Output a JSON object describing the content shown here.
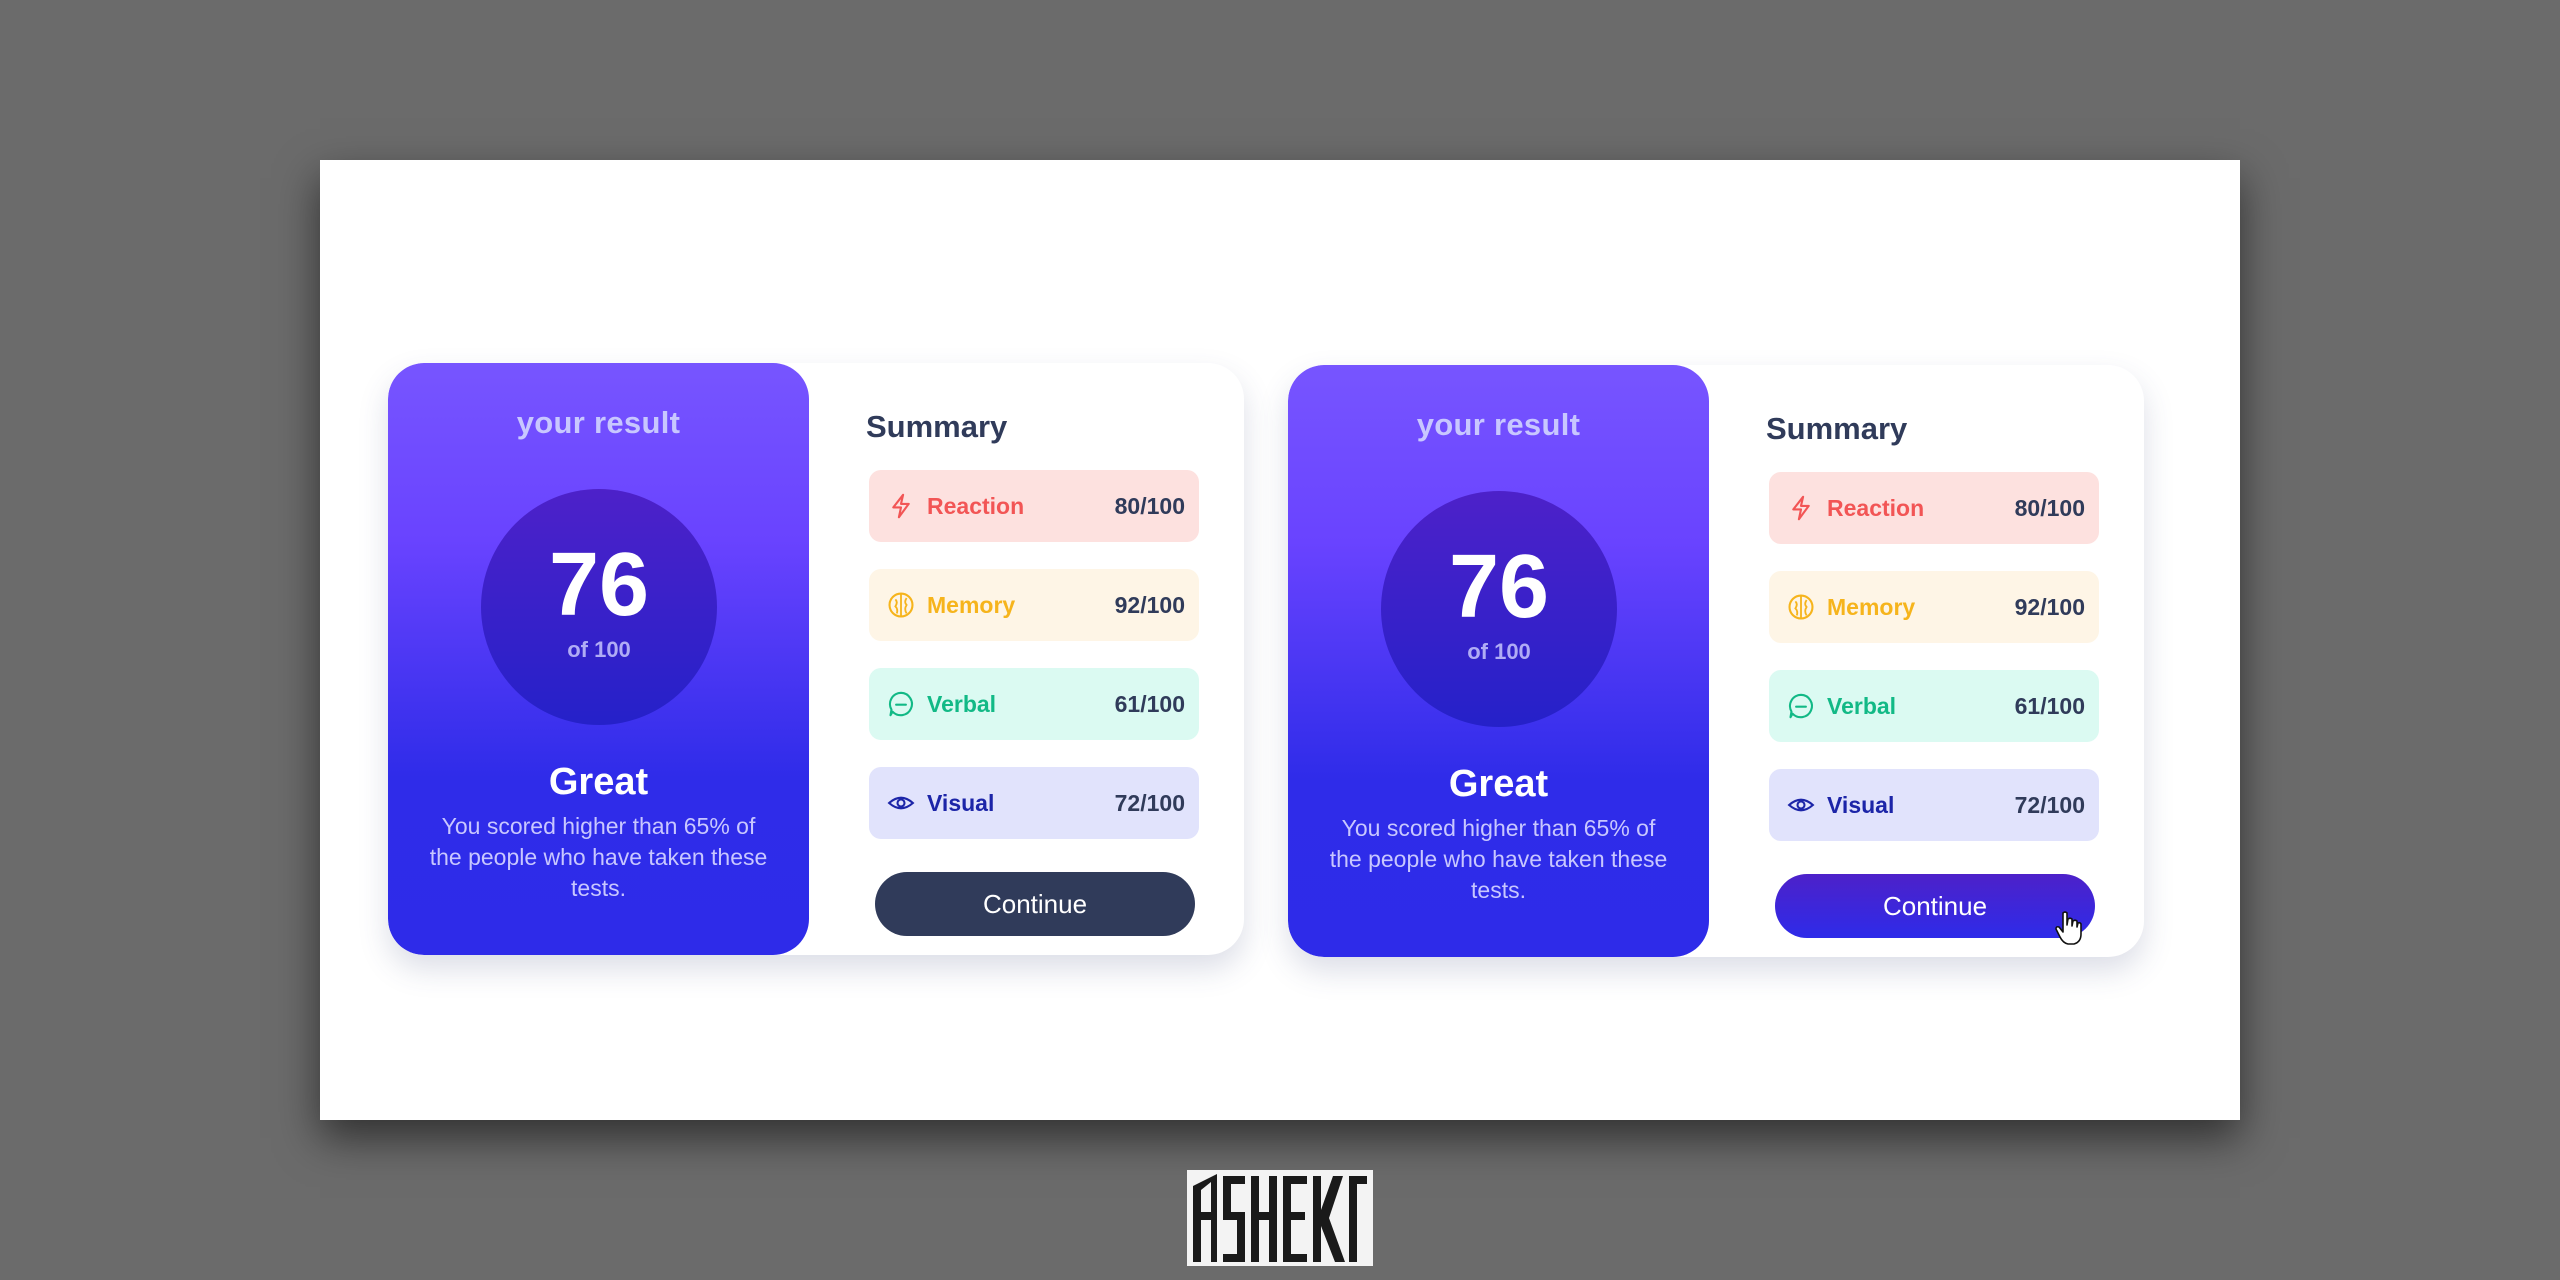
{
  "cards": [
    {
      "result_title": "your result",
      "score": "76",
      "score_of": "of 100",
      "grade": "Great",
      "description": "You scored higher than 65% of the people who have taken these tests.",
      "summary_title": "Summary",
      "rows": [
        {
          "icon": "lightning-icon",
          "label": "Reaction",
          "value": "80/100"
        },
        {
          "icon": "brain-icon",
          "label": "Memory",
          "value": "92/100"
        },
        {
          "icon": "chat-bubble-icon",
          "label": "Verbal",
          "value": "61/100"
        },
        {
          "icon": "eye-icon",
          "label": "Visual",
          "value": "72/100"
        }
      ],
      "button": "Continue",
      "button_state": "default"
    },
    {
      "result_title": "your result",
      "score": "76",
      "score_of": "of 100",
      "grade": "Great",
      "description": "You scored higher than 65% of the people who have taken these tests.",
      "summary_title": "Summary",
      "rows": [
        {
          "icon": "lightning-icon",
          "label": "Reaction",
          "value": "80/100"
        },
        {
          "icon": "brain-icon",
          "label": "Memory",
          "value": "92/100"
        },
        {
          "icon": "chat-bubble-icon",
          "label": "Verbal",
          "value": "61/100"
        },
        {
          "icon": "eye-icon",
          "label": "Visual",
          "value": "72/100"
        }
      ],
      "button": "Continue",
      "button_state": "hover"
    }
  ],
  "colors": {
    "reaction": "#f25555",
    "memory": "#f6b41c",
    "verbal": "#12b986",
    "visual": "#1c25a8",
    "button_default": "#303b5a",
    "button_hover": "#2e2be9"
  },
  "logo": {
    "icon": "signature-logo"
  }
}
